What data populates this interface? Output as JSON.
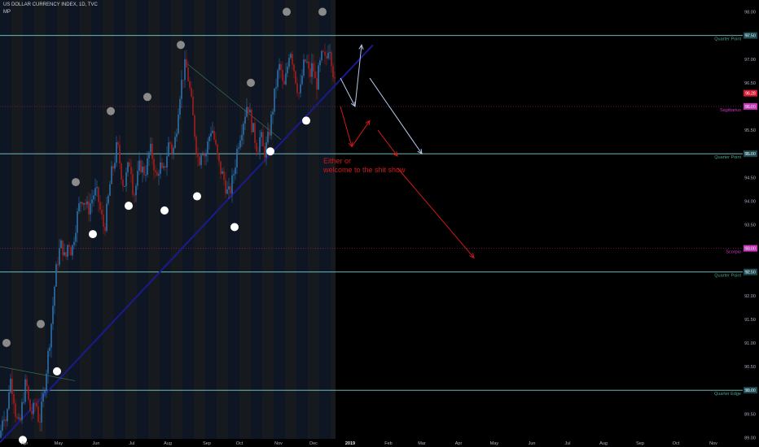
{
  "header": {
    "symbol_line": "US DOLLAR CURRENCY INDEX, 1D, TVC",
    "indicator": "MP"
  },
  "annotation": {
    "line1": "Either or",
    "line2": "welcome to the shit show"
  },
  "colors": {
    "background": "#000000",
    "history_band_a": "#0d1622",
    "history_band_b": "#161a1f",
    "quarter_line": "#7fd0d0",
    "astro_line": "#a0206a",
    "astro_label": "#d030c0",
    "trendline": "#1a1a8c",
    "candle_up": "#2f6fa8",
    "candle_down": "#a01e1e",
    "arrow_red": "#d01818",
    "arrow_white": "#b8c8ec",
    "price_tag": "#d81830"
  },
  "chart_data": {
    "type": "candlestick",
    "y_axis_labels": [
      "98.00",
      "97.50",
      "97.00",
      "96.50",
      "96.00",
      "95.50",
      "95.00",
      "94.50",
      "94.00",
      "93.50",
      "93.00",
      "92.50",
      "92.00",
      "91.50",
      "91.00",
      "90.50",
      "90.00",
      "89.50",
      "89.00"
    ],
    "x_axis_labels": [
      "Apr",
      "May",
      "Jun",
      "Jul",
      "Aug",
      "Sep",
      "Oct",
      "Nov",
      "Dec",
      "2019",
      "Feb",
      "Mar",
      "Apr",
      "May",
      "Jun",
      "Jul",
      "Aug",
      "Sep",
      "Oct",
      "Nov"
    ],
    "ylim": [
      88.8,
      98.25
    ],
    "last_price": "96.28",
    "horizontal_levels": [
      {
        "label": "Quarter Point",
        "value": 97.5,
        "tag": "97.50",
        "kind": "quarter"
      },
      {
        "label": "Sagittarius",
        "value": 96.0,
        "tag": "96.00",
        "kind": "astro"
      },
      {
        "label": "Quarter Point",
        "value": 95.0,
        "tag": "95.00",
        "kind": "quarter"
      },
      {
        "label": "Scorpio",
        "value": 93.0,
        "tag": "93.00",
        "kind": "astro"
      },
      {
        "label": "Quarter Point",
        "value": 92.5,
        "tag": "92.50",
        "kind": "quarter"
      },
      {
        "label": "Quarter Edge",
        "value": 90.0,
        "tag": "90.00",
        "kind": "quarter"
      }
    ],
    "close_path": [
      [
        0,
        89.0
      ],
      [
        4,
        89.6
      ],
      [
        8,
        89.3
      ],
      [
        12,
        90.3
      ],
      [
        16,
        90.0
      ],
      [
        20,
        89.4
      ],
      [
        24,
        89.2
      ],
      [
        28,
        89.8
      ],
      [
        32,
        90.2
      ],
      [
        36,
        89.6
      ],
      [
        40,
        89.5
      ],
      [
        44,
        89.8
      ],
      [
        48,
        89.3
      ],
      [
        52,
        89.7
      ],
      [
        56,
        90.3
      ],
      [
        60,
        90.9
      ],
      [
        64,
        91.6
      ],
      [
        68,
        92.4
      ],
      [
        72,
        92.9
      ],
      [
        76,
        93.1
      ],
      [
        80,
        92.7
      ],
      [
        84,
        93.2
      ],
      [
        88,
        92.9
      ],
      [
        92,
        93.4
      ],
      [
        96,
        93.8
      ],
      [
        100,
        94.1
      ],
      [
        104,
        94.0
      ],
      [
        108,
        93.8
      ],
      [
        112,
        94.0
      ],
      [
        116,
        94.2
      ],
      [
        120,
        94.1
      ],
      [
        124,
        93.7
      ],
      [
        128,
        93.4
      ],
      [
        132,
        93.9
      ],
      [
        136,
        94.5
      ],
      [
        140,
        94.8
      ],
      [
        144,
        95.2
      ],
      [
        148,
        94.7
      ],
      [
        152,
        94.3
      ],
      [
        156,
        94.6
      ],
      [
        160,
        94.9
      ],
      [
        164,
        94.1
      ],
      [
        168,
        94.4
      ],
      [
        172,
        94.8
      ],
      [
        176,
        94.6
      ],
      [
        180,
        94.7
      ],
      [
        184,
        95.1
      ],
      [
        188,
        94.9
      ],
      [
        192,
        94.4
      ],
      [
        196,
        94.8
      ],
      [
        200,
        94.5
      ],
      [
        204,
        94.9
      ],
      [
        208,
        95.3
      ],
      [
        212,
        95.0
      ],
      [
        216,
        95.4
      ],
      [
        220,
        96.2
      ],
      [
        224,
        96.6
      ],
      [
        228,
        96.9
      ],
      [
        232,
        96.5
      ],
      [
        236,
        95.9
      ],
      [
        240,
        95.3
      ],
      [
        244,
        94.8
      ],
      [
        248,
        95.2
      ],
      [
        252,
        94.9
      ],
      [
        256,
        95.3
      ],
      [
        260,
        95.6
      ],
      [
        264,
        95.2
      ],
      [
        268,
        94.8
      ],
      [
        272,
        94.6
      ],
      [
        276,
        94.4
      ],
      [
        280,
        94.1
      ],
      [
        284,
        94.3
      ],
      [
        288,
        94.7
      ],
      [
        292,
        95.2
      ],
      [
        296,
        95.5
      ],
      [
        300,
        95.8
      ],
      [
        304,
        96.1
      ],
      [
        308,
        95.7
      ],
      [
        312,
        95.4
      ],
      [
        316,
        95.1
      ],
      [
        320,
        95.4
      ],
      [
        324,
        95.0
      ],
      [
        328,
        95.2
      ],
      [
        332,
        95.6
      ],
      [
        336,
        96.1
      ],
      [
        340,
        96.6
      ],
      [
        344,
        96.9
      ],
      [
        348,
        96.3
      ],
      [
        352,
        96.7
      ],
      [
        356,
        97.3
      ],
      [
        360,
        96.9
      ],
      [
        364,
        96.5
      ],
      [
        368,
        96.2
      ],
      [
        372,
        96.8
      ],
      [
        376,
        97.0
      ],
      [
        380,
        96.6
      ],
      [
        384,
        96.9
      ],
      [
        388,
        96.4
      ],
      [
        392,
        96.8
      ],
      [
        396,
        97.1
      ],
      [
        400,
        96.9
      ],
      [
        404,
        97.4
      ],
      [
        408,
        96.9
      ],
      [
        412,
        96.3
      ]
    ],
    "swing_lows": [
      [
        28,
        88.95
      ],
      [
        70,
        90.4
      ],
      [
        114,
        93.3
      ],
      [
        158,
        93.9
      ],
      [
        202,
        93.8
      ],
      [
        242,
        94.1
      ],
      [
        288,
        93.45
      ],
      [
        332,
        95.05
      ],
      [
        376,
        95.7
      ]
    ],
    "swing_highs": [
      [
        8,
        91.0
      ],
      [
        50,
        91.4
      ],
      [
        93,
        94.4
      ],
      [
        136,
        95.9
      ],
      [
        181,
        96.2
      ],
      [
        222,
        97.3
      ],
      [
        308,
        96.5
      ],
      [
        352,
        98.0
      ],
      [
        396,
        98.0
      ]
    ],
    "trendlines": [
      {
        "from": [
          0,
          88.9
        ],
        "to": [
          458,
          97.3
        ],
        "kind": "main"
      },
      {
        "from": [
          0,
          90.5
        ],
        "to": [
          92,
          90.2
        ],
        "kind": "minor"
      },
      {
        "from": [
          230,
          96.9
        ],
        "to": [
          345,
          95.3
        ],
        "kind": "minor"
      }
    ],
    "arrows_white": [
      [
        [
          418,
          96.6
        ],
        [
          436,
          96.0
        ]
      ],
      [
        [
          436,
          96.0
        ],
        [
          444,
          97.3
        ]
      ],
      [
        [
          454,
          96.6
        ],
        [
          518,
          95.0
        ]
      ]
    ],
    "arrows_red": [
      [
        [
          418,
          96.0
        ],
        [
          432,
          95.15
        ]
      ],
      [
        [
          432,
          95.15
        ],
        [
          454,
          95.7
        ]
      ],
      [
        [
          464,
          95.5
        ],
        [
          488,
          94.95
        ]
      ],
      [
        [
          488,
          94.7
        ],
        [
          582,
          92.8
        ]
      ]
    ]
  }
}
